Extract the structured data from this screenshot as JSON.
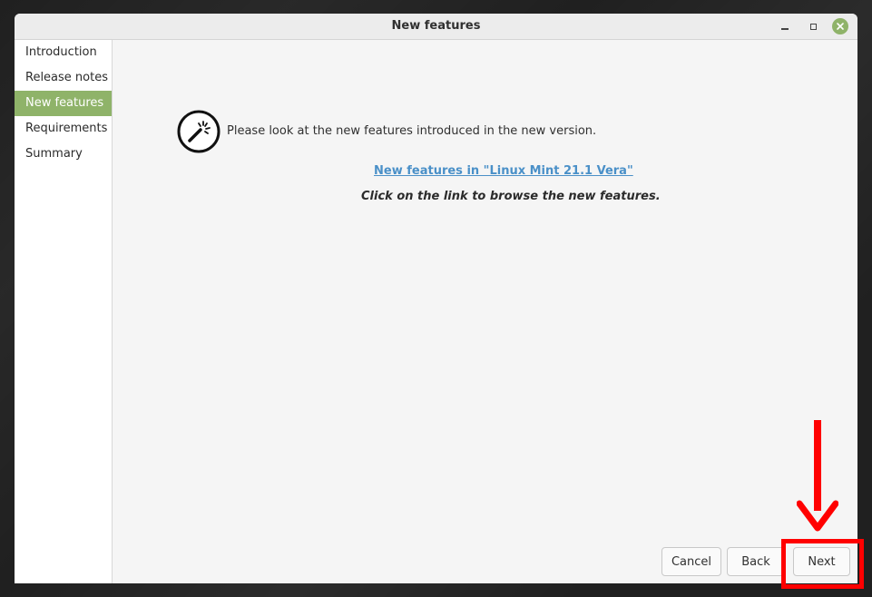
{
  "window": {
    "title": "New features"
  },
  "sidebar": {
    "items": [
      {
        "label": "Introduction",
        "active": false
      },
      {
        "label": "Release notes",
        "active": false
      },
      {
        "label": "New features",
        "active": true
      },
      {
        "label": "Requirements",
        "active": false
      },
      {
        "label": "Summary",
        "active": false
      }
    ]
  },
  "content": {
    "icon": "magic-wand-icon",
    "intro_text": "Please look at the new features introduced in the new version.",
    "link_text": "New features in \"Linux Mint 21.1 Vera\"",
    "hint_text": "Click on the link to browse the new features."
  },
  "buttons": {
    "cancel_label": "Cancel",
    "back_label": "Back",
    "next_label": "Next"
  },
  "annotation": {
    "color": "#ff0000",
    "target": "Next"
  },
  "colors": {
    "accent": "#8fb369",
    "link": "#4a90c8"
  }
}
